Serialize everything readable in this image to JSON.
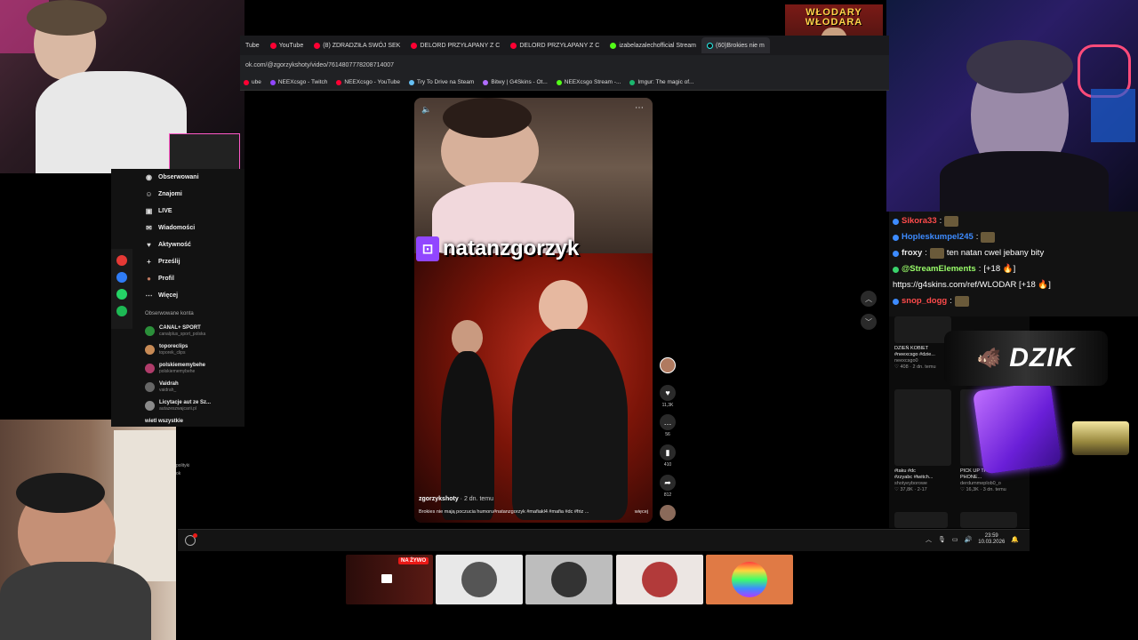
{
  "browser": {
    "tabs": [
      {
        "label": "Tube",
        "type": "yt"
      },
      {
        "label": "YouTube",
        "type": "yt"
      },
      {
        "label": "(8) ZDRADZIŁA SWÓJ SEK",
        "type": "yt"
      },
      {
        "label": "DELORD PRZYŁAPANY Z C",
        "type": "yt"
      },
      {
        "label": "DELORD PRZYŁAPANY Z C",
        "type": "yt"
      },
      {
        "label": "izabelazalechofficial Stream",
        "type": "kick"
      },
      {
        "label": "(60)Brokies nie m",
        "type": "tt"
      }
    ],
    "url": "ok.com/@zgorzykshoty/video/7614807778208714007",
    "bookmarks": [
      {
        "label": "ube",
        "color": "#ff0033"
      },
      {
        "label": "NEEXcsgo - Twitch",
        "color": "#9146ff"
      },
      {
        "label": "NEEXcsgo - YouTube",
        "color": "#ff0033"
      },
      {
        "label": "Try To Drive na Steam",
        "color": "#66c0f4"
      },
      {
        "label": "Bitwy | G4Skins - Ot...",
        "color": "#b06cff"
      },
      {
        "label": "NEEXcsgo Stream -...",
        "color": "#53fc18"
      },
      {
        "label": "Imgur: The magic of...",
        "color": "#1bb76e"
      }
    ]
  },
  "sidebar": {
    "nav": [
      {
        "label": "Obserwowani",
        "icon": "people-icon"
      },
      {
        "label": "Znajomi",
        "icon": "friends-icon"
      },
      {
        "label": "LIVE",
        "icon": "live-icon"
      },
      {
        "label": "Wiadomości",
        "icon": "message-icon"
      },
      {
        "label": "Aktywność",
        "icon": "activity-icon"
      },
      {
        "label": "Prześlij",
        "icon": "upload-icon"
      },
      {
        "label": "Profil",
        "icon": "profile-icon"
      },
      {
        "label": "Więcej",
        "icon": "more-icon"
      }
    ],
    "following_title": "Obserwowane konta",
    "following": [
      {
        "name": "CANAL+ SPORT",
        "handle": "canalplus_sport_polska"
      },
      {
        "name": "toporeclips",
        "handle": "toporek_clips"
      },
      {
        "name": "polskiememybehe",
        "handle": "polskiememybehe"
      },
      {
        "name": "Vaidrah",
        "handle": "vaidrah_"
      },
      {
        "name": "Licytacje aut ze Sz...",
        "handle": "autazeszwajcarii.pl"
      }
    ],
    "see_all": "wietl wszystkie",
    "peek": [
      "polityki",
      "ok"
    ]
  },
  "video": {
    "overlay_name": "natanzgorzyk",
    "author": "zgorzykshoty",
    "date": " · 2 dn. temu",
    "caption": "Brokies nie mają poczucia humoru#natanzgorzyk #mafiakl4 #mafia #dc #friz ...",
    "more": "więcej"
  },
  "actions": [
    {
      "name": "like",
      "icon": "♥",
      "count": "11,3K"
    },
    {
      "name": "comment",
      "icon": "…",
      "count": "56"
    },
    {
      "name": "save",
      "icon": "▮",
      "count": "410"
    },
    {
      "name": "share",
      "icon": "➦",
      "count": "812"
    }
  ],
  "chat": [
    {
      "user": "Sikora33",
      "color": "#ff4b4b",
      "text": "",
      "emote": true
    },
    {
      "user": "Hopleskumpel245",
      "color": "#3d8bff",
      "text": "",
      "emote": true
    },
    {
      "user": "froxy",
      "color": "#e8e8e8",
      "text": "ten natan cwel jebany bity",
      "emote": true
    },
    {
      "user": "@StreamElements",
      "color": "#9aff6a",
      "text": "[+18 🔥]",
      "emote": false
    },
    {
      "user": "",
      "color": "#fff",
      "text": "https://g4skins.com/ref/WLODAR [+18 🔥]",
      "emote": false
    },
    {
      "user": "snop_dogg",
      "color": "#ff4b4b",
      "text": "",
      "emote": true
    }
  ],
  "right_grid": [
    {
      "title": "DZIEŃ KOBIET",
      "desc": "#neexcsgo #dzie...",
      "author": "neexcsgo0",
      "meta": "♡ 408 · 2 dn. temu"
    },
    {
      "title": "#taku #dc",
      "desc": "#zzyabc #twitch...",
      "author": "shotyeyborowe",
      "meta": "♡ 37,8K · 2-17"
    },
    {
      "title": "PICK UP THE",
      "desc": "PHONE...",
      "author": "derdummeplob0_o",
      "meta": "♡ 16,3K · 3 dn. temu"
    }
  ],
  "overlay": {
    "brand": "DZIK",
    "sign": "WŁODARY WŁODARA"
  },
  "taskbar": {
    "time": "23:59",
    "date": "10.03.2026"
  },
  "thumb_badge": "NA ŻYWO",
  "colors": {
    "tiktok_red": "#fe2c55",
    "twitch_purple": "#9146ff",
    "live_red": "#e91916"
  }
}
